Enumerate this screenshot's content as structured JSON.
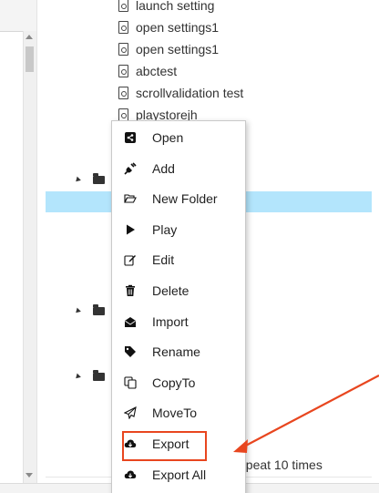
{
  "tree": {
    "items": [
      {
        "label": "launch setting"
      },
      {
        "label": "open settings1"
      },
      {
        "label": "open settings1"
      },
      {
        "label": "abctest"
      },
      {
        "label": "scrollvalidation test"
      },
      {
        "label": "playstorejh"
      }
    ],
    "background_text": "epeat 10 times"
  },
  "context_menu": {
    "items": [
      {
        "label": "Open",
        "icon": "share-icon"
      },
      {
        "label": "Add",
        "icon": "plug-icon"
      },
      {
        "label": "New Folder",
        "icon": "folder-open-icon"
      },
      {
        "label": "Play",
        "icon": "play-icon"
      },
      {
        "label": "Edit",
        "icon": "edit-icon"
      },
      {
        "label": "Delete",
        "icon": "trash-icon"
      },
      {
        "label": "Import",
        "icon": "envelope-open-icon"
      },
      {
        "label": "Rename",
        "icon": "tag-icon"
      },
      {
        "label": "CopyTo",
        "icon": "copy-icon"
      },
      {
        "label": "MoveTo",
        "icon": "paper-plane-icon"
      },
      {
        "label": "Export",
        "icon": "cloud-download-icon"
      },
      {
        "label": "Export All",
        "icon": "cloud-download-icon"
      }
    ]
  },
  "annotation": {
    "highlight_color": "#e8461f",
    "highlighted_item": "Export"
  },
  "colors": {
    "selection": "#b3e5fc",
    "annotation": "#e8461f"
  }
}
